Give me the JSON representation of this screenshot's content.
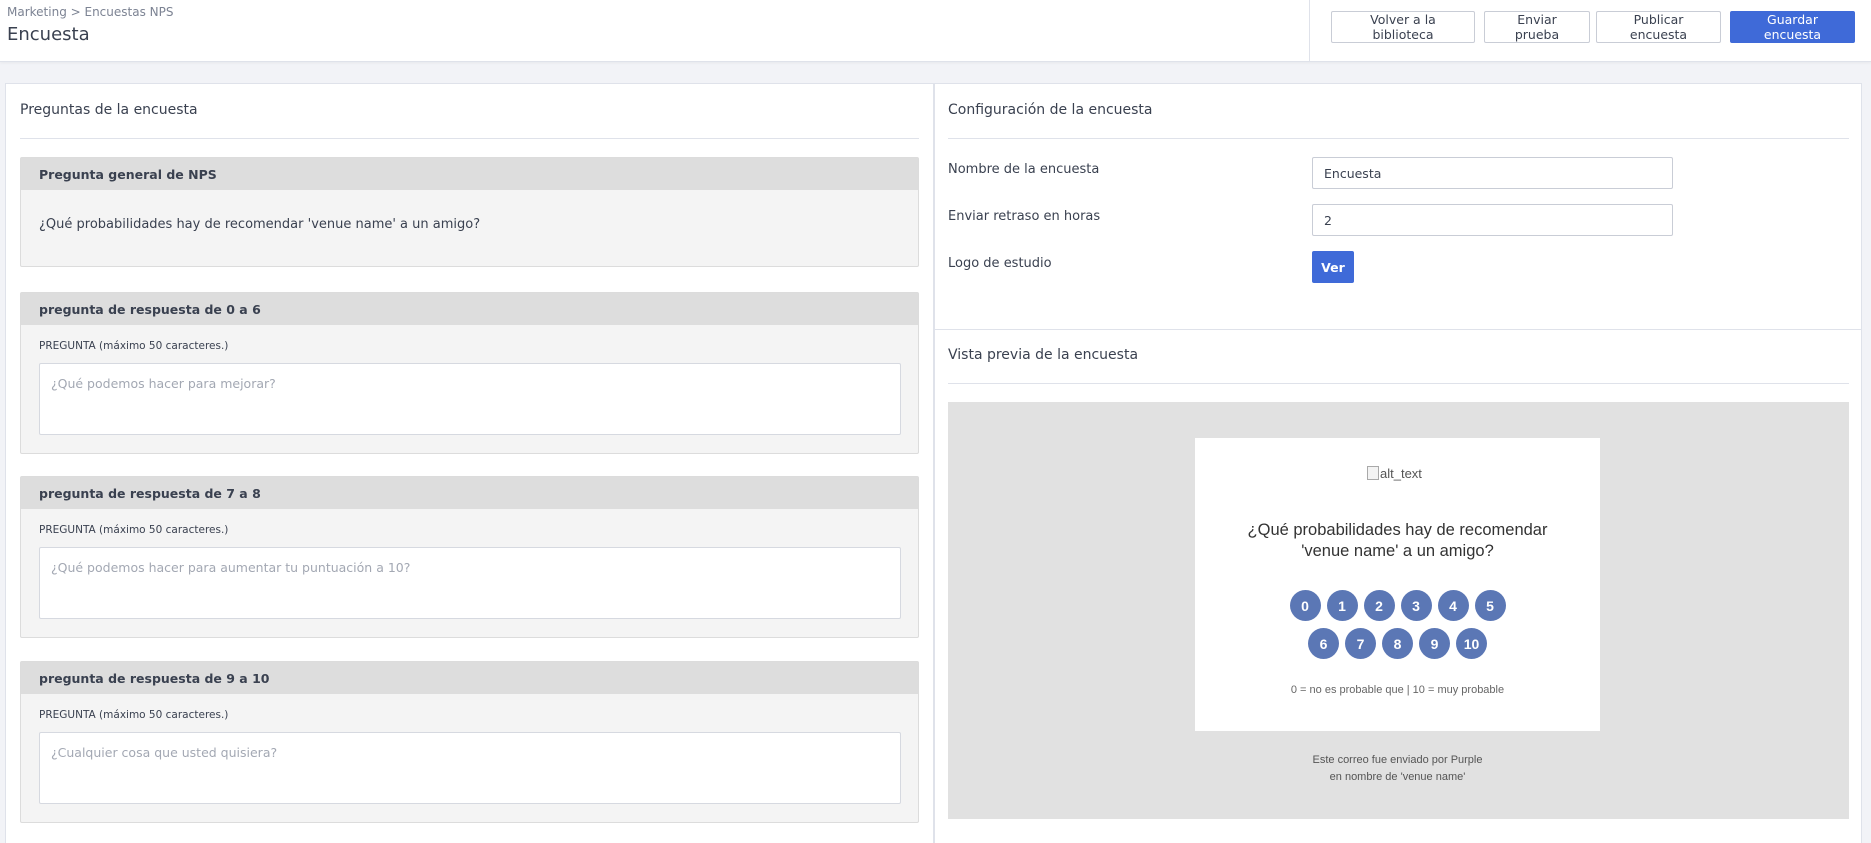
{
  "header": {
    "breadcrumb": "Marketing > Encuestas NPS",
    "title": "Encuesta",
    "buttons": {
      "back": "Volver a la biblioteca",
      "send_test": "Enviar prueba",
      "publish": "Publicar encuesta",
      "save": "Guardar encuesta"
    },
    "accent_color": "#3f6ad8"
  },
  "questions_panel": {
    "title": "Preguntas de la encuesta",
    "general": {
      "heading": "Pregunta general de NPS",
      "text": "¿Qué probabilidades hay de recomendar 'venue name' a un amigo?"
    },
    "cards": [
      {
        "heading": "pregunta de respuesta de 0 a 6",
        "field_label": "PREGUNTA (máximo 50 caracteres.)",
        "placeholder": "¿Qué podemos hacer para mejorar?"
      },
      {
        "heading": "pregunta de respuesta de 7 a 8",
        "field_label": "PREGUNTA (máximo 50 caracteres.)",
        "placeholder": "¿Qué podemos hacer para aumentar tu puntuación a 10?"
      },
      {
        "heading": "pregunta de respuesta de 9 a 10",
        "field_label": "PREGUNTA (máximo 50 caracteres.)",
        "placeholder": "¿Cualquier cosa que usted quisiera?"
      }
    ]
  },
  "config_panel": {
    "title": "Configuración de la encuesta",
    "name_label": "Nombre de la encuesta",
    "name_value": "Encuesta",
    "delay_label": "Enviar retraso en horas",
    "delay_value": "2",
    "logo_label": "Logo de estudio",
    "view_button": "Ver"
  },
  "preview": {
    "title": "Vista previa de la encuesta",
    "logo_alt": "alt_text",
    "question": "¿Qué probabilidades hay de recomendar 'venue name' a un amigo?",
    "scores_row1": [
      "0",
      "1",
      "2",
      "3",
      "4",
      "5"
    ],
    "scores_row2": [
      "6",
      "7",
      "8",
      "9",
      "10"
    ],
    "scale_note": "0 = no es probable que | 10 = muy probable",
    "footer_line1": "Este correo fue enviado por Purple",
    "footer_line2": "en nombre de 'venue name'",
    "score_color": "#5b77b5"
  }
}
